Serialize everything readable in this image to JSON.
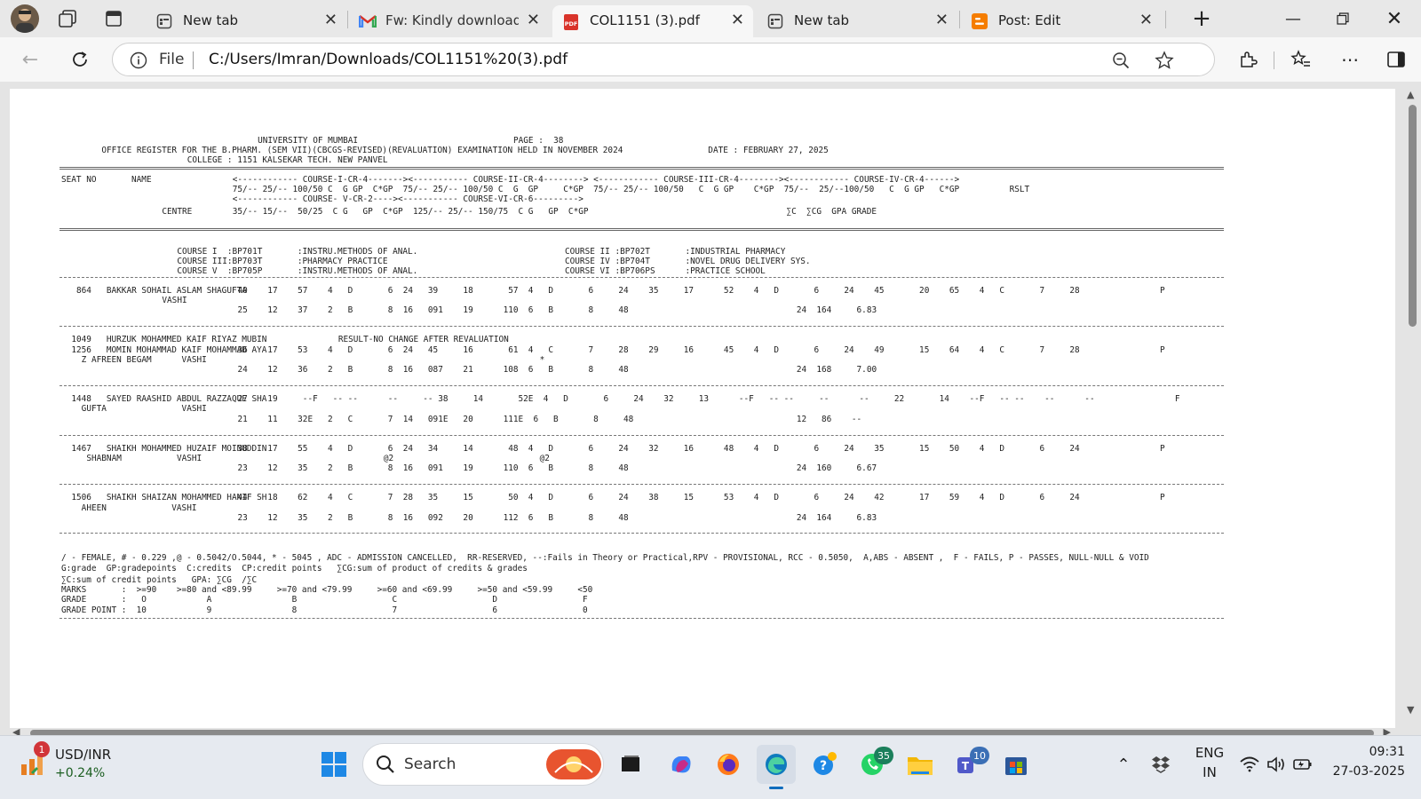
{
  "browser": {
    "tabs": [
      {
        "label": "New tab",
        "icon": "new-tab-icon",
        "active": false
      },
      {
        "label": "Fw: Kindly download RE",
        "icon": "gmail-icon",
        "active": false
      },
      {
        "label": "COL1151 (3).pdf",
        "icon": "pdf-icon",
        "active": true
      },
      {
        "label": "New tab",
        "icon": "new-tab-icon",
        "active": false
      },
      {
        "label": "Post: Edit",
        "icon": "blogger-icon",
        "active": false
      }
    ],
    "address": {
      "scheme_label": "File",
      "url": "C:/Users/Imran/Downloads/COL1151%20(3).pdf"
    }
  },
  "document": {
    "header": [
      {
        "text": "UNIVERSITY OF MUMBAI                               PAGE :  38",
        "col": 39
      },
      {
        "text": "OFFICE REGISTER FOR THE B.PHARM. (SEM VII)(CBCGS-REVISED)(REVALUATION) EXAMINATION HELD IN NOVEMBER 2024                 DATE : FEBRUARY 27, 2025",
        "col": 8
      },
      {
        "text": "COLLEGE : 1151 KALSEKAR TECH. NEW PANVEL",
        "col": 25
      }
    ],
    "columns": [
      {
        "text": "SEAT NO       NAME",
        "col": 0
      },
      {
        "text": "<------------ COURSE-I-CR-4-------><----------- COURSE-II-CR-4--------> <------------ COURSE-III-CR-4--------><------------ COURSE-IV-CR-4------>",
        "col": 34
      },
      {
        "text": "75/-- 25/-- 100/50 C  G GP  C*GP  75/-- 25/-- 100/50 C  G  GP     C*GP  75/-- 25/-- 100/50   C  G GP    C*GP  75/--  25/--100/50   C  G GP   C*GP          RSLT",
        "col": 34
      },
      {
        "text": "<------------ COURSE- V-CR-2----><----------- COURSE-VI-CR-6--------->",
        "col": 34
      },
      {
        "text": "CENTRE",
        "col": 20
      },
      {
        "text": "35/-- 15/--  50/25  C G   GP  C*GP  125/-- 25/-- 150/75  C G   GP  C*GP",
        "col": 34
      },
      {
        "text": "∑C  ∑CG  GPA GRADE",
        "col": 144
      }
    ],
    "courses": [
      {
        "text": "COURSE I  :BP701T       :INSTRU.METHODS OF ANAL.",
        "col": 23
      },
      {
        "text": "COURSE II :BP702T       :INDUSTRIAL PHARMACY",
        "col": 100
      },
      {
        "text": "COURSE III:BP703T       :PHARMACY PRACTICE",
        "col": 23
      },
      {
        "text": "COURSE IV :BP704T       :NOVEL DRUG DELIVERY SYS.",
        "col": 100
      },
      {
        "text": "COURSE V  :BP705P       :INSTRU.METHODS OF ANAL.",
        "col": 23
      },
      {
        "text": "COURSE VI :BP706PS      :PRACTICE SCHOOL",
        "col": 100
      }
    ],
    "records": [
      {
        "lines": [
          {
            "text": "864   BAKKAR SOHAIL ASLAM SHAGUFTA",
            "col": 3
          },
          {
            "text": "40    17    57    4   D       6  24   39     18       57  4   D       6     24    35     17      52    4   D       6     24    45       20    65    4   C       7     28                P",
            "col": 35
          },
          {
            "text": "VASHI",
            "col": 20
          },
          {
            "text": "25    12    37    2   B       8  16   091    19      110  6   B       8     48",
            "col": 35
          },
          {
            "text": "24  164     6.83",
            "col": 146
          }
        ]
      },
      {
        "lines": [
          {
            "text": "1049   HURZUK MOHAMMED KAIF RIYAZ MUBIN",
            "col": 2
          },
          {
            "text": "RESULT-NO CHANGE AFTER REVALUATION",
            "col": 55
          },
          {
            "text": "1256   MOMIN MOHAMMAD KAIF MOHAMMAD AYA",
            "col": 2
          },
          {
            "text": "36    17    53    4   D       6  24   45     16       61  4   C       7     28    29     16      45    4   D       6     24    49       15    64    4   C       7     28                P",
            "col": 35
          },
          {
            "text": "Z AFREEN BEGAM      VASHI",
            "col": 4
          },
          {
            "text": "*",
            "col": 95
          },
          {
            "text": "24    12    36    2   B       8  16   087    21      108  6   B       8     48",
            "col": 35
          },
          {
            "text": "24  168     7.00",
            "col": 146
          }
        ]
      },
      {
        "lines": [
          {
            "text": "1448   SAYED RAASHID ABDUL RAZZAQUE SHA",
            "col": 2
          },
          {
            "text": "27    19     --F   -- --      --     -- 38     14       52E  4   D       6     24    32     13      --F   -- --     --      --     22       14    --F   -- --    --      --                F",
            "col": 35
          },
          {
            "text": "GUFTA               VASHI",
            "col": 4
          },
          {
            "text": "21    11    32E   2   C       7  14   091E   20      111E  6   B       8     48",
            "col": 35
          },
          {
            "text": "12   86    --",
            "col": 146
          }
        ]
      },
      {
        "lines": [
          {
            "text": "1467   SHAIKH MOHAMMED HUZAIF MOINUDDIN",
            "col": 2
          },
          {
            "text": "38    17    55    4   D       6  24   34     14       48  4   D       6     24    32     16      48    4   D       6     24    35       15    50    4   D       6     24                P",
            "col": 35
          },
          {
            "text": "SHABNAM           VASHI",
            "col": 5
          },
          {
            "text": "@2",
            "col": 64
          },
          {
            "text": "@2",
            "col": 95
          },
          {
            "text": "23    12    35    2   B       8  16   091    19      110  6   B       8     48",
            "col": 35
          },
          {
            "text": "24  160     6.67",
            "col": 146
          }
        ]
      },
      {
        "lines": [
          {
            "text": "1506   SHAIKH SHAIZAN MOHAMMED HANIF SH",
            "col": 2
          },
          {
            "text": "44    18    62    4   C       7  28   35     15       50  4   D       6     24    38     15      53    4   D       6     24    42       17    59    4   D       6     24                P",
            "col": 35
          },
          {
            "text": "AHEEN             VASHI",
            "col": 4
          },
          {
            "text": "23    12    35    2   B       8  16   092    20      112  6   B       8     48",
            "col": 35
          },
          {
            "text": "24  164     6.83",
            "col": 146
          }
        ]
      }
    ],
    "legend": [
      "/ - FEMALE, # - 0.229 ,@ - 0.5042/O.5044, * - 5045 , ADC - ADMISSION CANCELLED,  RR-RESERVED, --:Fails in Theory or Practical,RPV - PROVISIONAL, RCC - 0.5050,  A,ABS - ABSENT ,  F - FAILS, P - PASSES, NULL-NULL & VOID",
      "G:grade  GP:gradepoints  C:credits  CP:credit points   ∑CG:sum of product of credits & grades",
      "∑C:sum of credit points   GPA: ∑CG  /∑C",
      "MARKS       :  >=90    >=80 and <89.99     >=70 and <79.99     >=60 and <69.99     >=50 and <59.99     <50",
      "GRADE       :   O            A                B                   C                   D                 F",
      "GRADE POINT :  10            9                8                   7                   6                 0"
    ]
  },
  "taskbar": {
    "weather_widget": {
      "title": "USD/INR",
      "change": "+0.24%",
      "badge": "1"
    },
    "search_placeholder": "Search",
    "badges": {
      "whatsapp": "35",
      "teams": "10"
    },
    "language": {
      "lang": "ENG",
      "region": "IN"
    },
    "clock": {
      "time": "09:31",
      "date": "27-03-2025"
    }
  }
}
